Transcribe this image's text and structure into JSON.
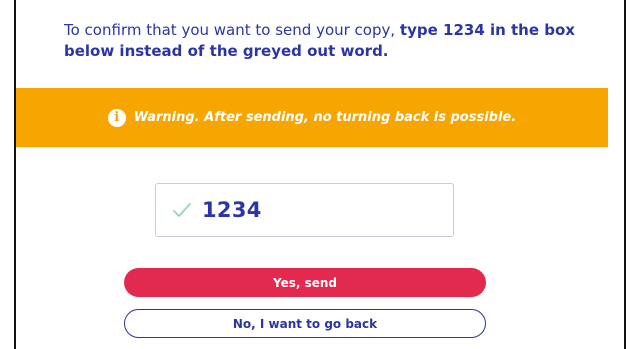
{
  "instruction": {
    "text_regular": "To confirm that you want to send your copy, ",
    "text_bold": "type 1234 in the box below instead of the greyed out word."
  },
  "warning": {
    "icon": "info-icon",
    "text": "Warning. After sending, no turning back is possible."
  },
  "confirmation_input": {
    "value": "1234",
    "status_icon": "check-icon"
  },
  "buttons": {
    "send_label": "Yes, send",
    "back_label": "No, I want to go back"
  },
  "colors": {
    "primary_text": "#2b35a6",
    "warning_bg": "#f7a500",
    "send_bg": "#e3294e",
    "check": "#9ad3b4"
  }
}
